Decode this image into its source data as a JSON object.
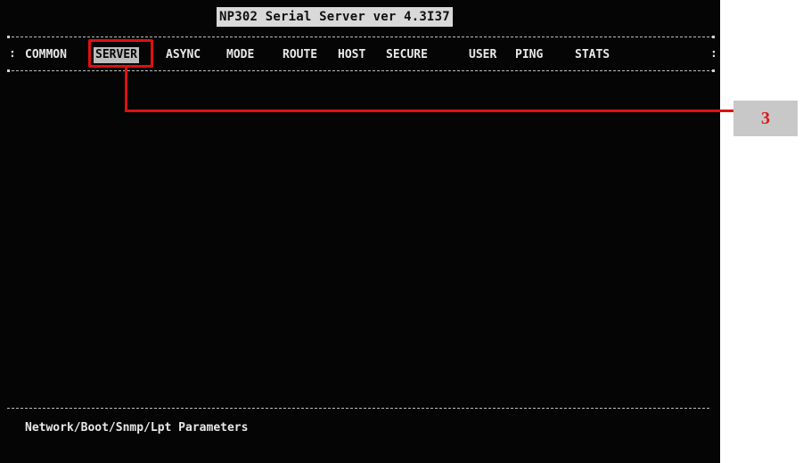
{
  "window": {
    "title": "NP302 Serial Server ver 4.3I37"
  },
  "menu": {
    "items": [
      {
        "id": "common",
        "label": "COMMON",
        "selected": false
      },
      {
        "id": "server",
        "label": "SERVER",
        "selected": true
      },
      {
        "id": "async",
        "label": "ASYNC",
        "selected": false
      },
      {
        "id": "mode",
        "label": "MODE",
        "selected": false
      },
      {
        "id": "route",
        "label": "ROUTE",
        "selected": false
      },
      {
        "id": "host",
        "label": "HOST",
        "selected": false
      },
      {
        "id": "secure",
        "label": "SECURE",
        "selected": false
      },
      {
        "id": "user",
        "label": "USER",
        "selected": false
      },
      {
        "id": "ping",
        "label": "PING",
        "selected": false
      },
      {
        "id": "stats",
        "label": "STATS",
        "selected": false
      }
    ],
    "side_glyph": ":"
  },
  "status": {
    "description": "Network/Boot/Snmp/Lpt Parameters"
  },
  "annotation": {
    "callout_number": "3",
    "color": "#e01010",
    "label_background": "#c8c8c8"
  },
  "colors": {
    "terminal_background": "#050505",
    "terminal_text": "#e8e8e8",
    "title_background": "#d9d9d9",
    "selected_background": "#bdbdbd"
  }
}
